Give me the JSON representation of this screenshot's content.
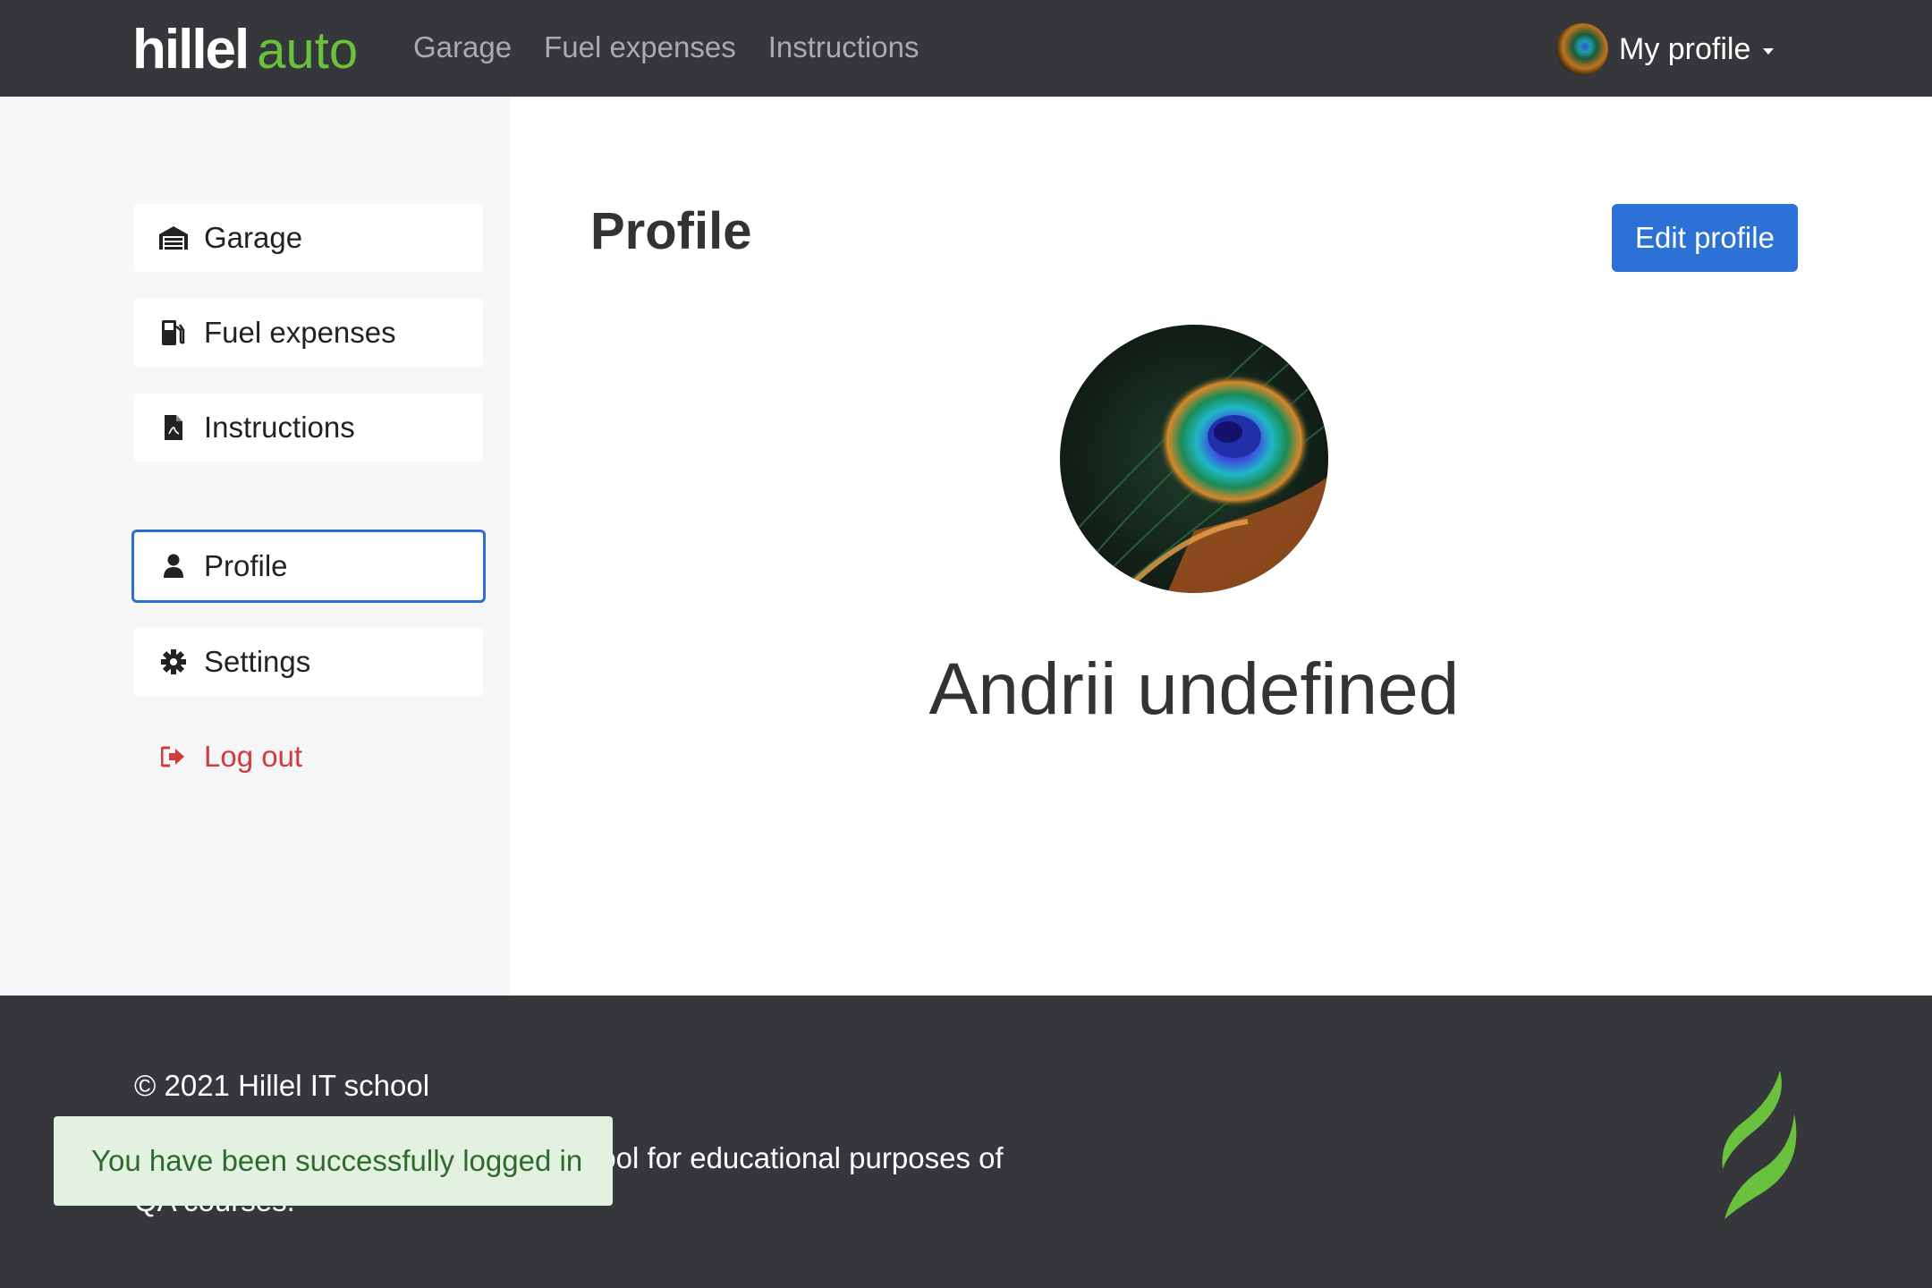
{
  "header": {
    "logo_main": "hillel",
    "logo_accent": "auto",
    "nav": [
      "Garage",
      "Fuel expenses",
      "Instructions"
    ],
    "profile_menu_label": "My profile"
  },
  "sidebar": {
    "items": [
      {
        "label": "Garage",
        "icon": "garage-icon"
      },
      {
        "label": "Fuel expenses",
        "icon": "fuel-pump-icon"
      },
      {
        "label": "Instructions",
        "icon": "pdf-document-icon"
      },
      {
        "label": "Profile",
        "icon": "user-icon",
        "active": true
      },
      {
        "label": "Settings",
        "icon": "gear-icon"
      },
      {
        "label": "Log out",
        "icon": "logout-icon"
      }
    ]
  },
  "main": {
    "title": "Profile",
    "edit_button": "Edit profile",
    "user_name": "Andrii undefined"
  },
  "footer": {
    "copyright": "© 2021 Hillel IT school",
    "description": "Hillel auto developed in Hillel IT school for educational purposes of QA courses."
  },
  "toast": {
    "message": "You have been successfully logged in"
  },
  "colors": {
    "header_bg": "#35373a",
    "accent_green": "#6ac13d",
    "primary_blue": "#2c72d6",
    "logout_red": "#d03b3b",
    "toast_bg": "#e3f1e0"
  }
}
